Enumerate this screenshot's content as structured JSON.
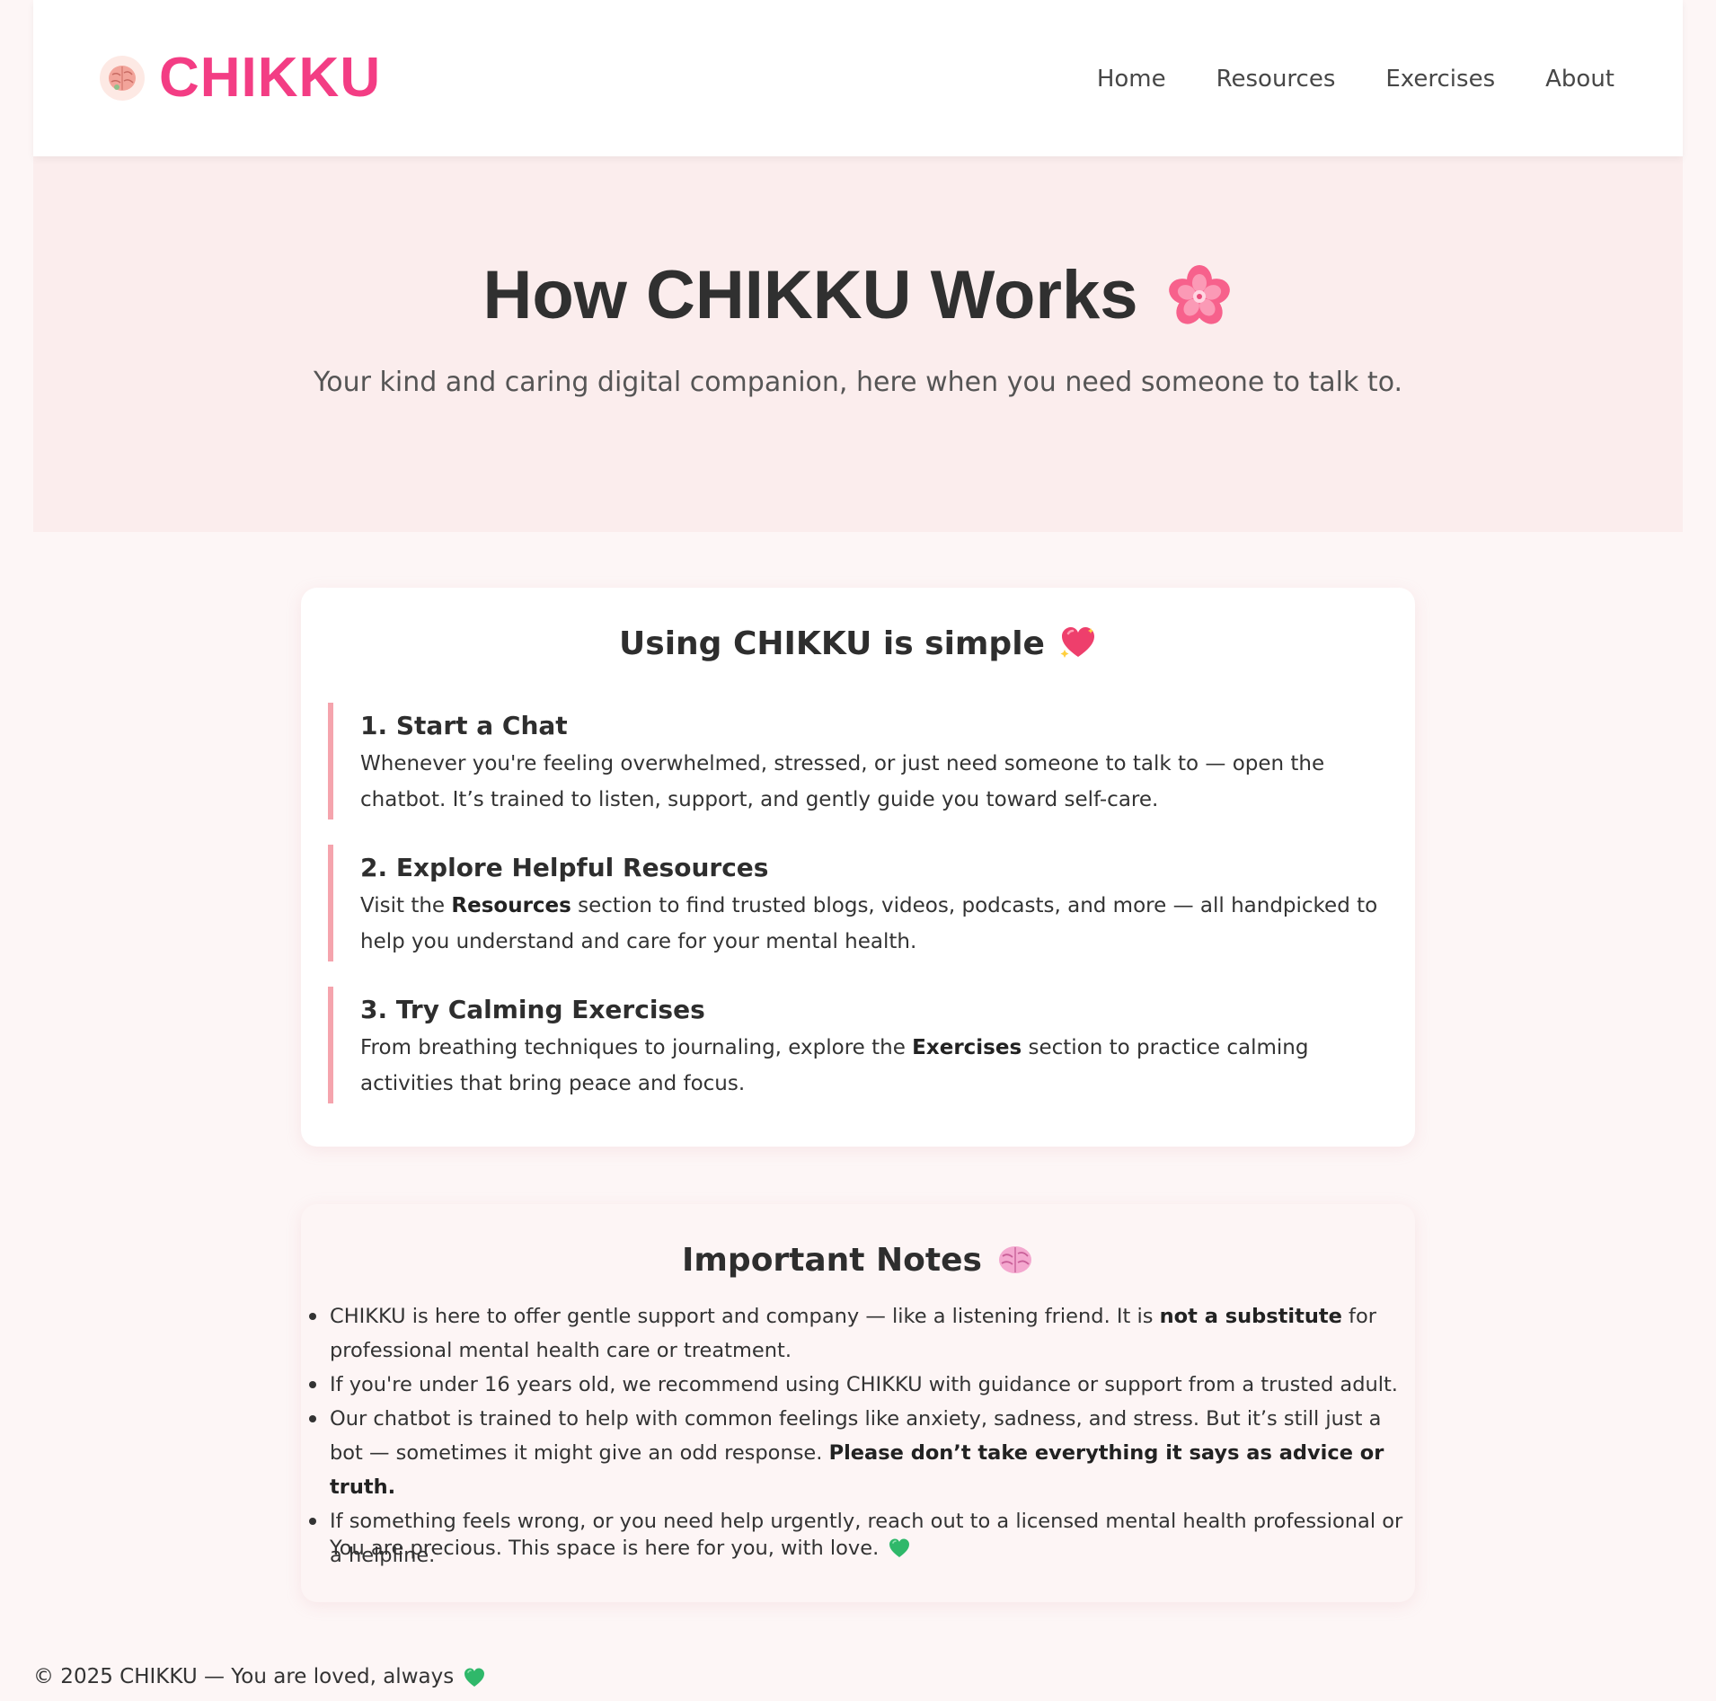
{
  "header": {
    "logo_text": "CHIKKU",
    "logo_icon": "brain-icon",
    "nav": [
      {
        "label": "Home"
      },
      {
        "label": "Resources"
      },
      {
        "label": "Exercises"
      },
      {
        "label": "About"
      }
    ]
  },
  "hero": {
    "title": "How CHIKKU Works",
    "title_icon": "cherry-blossom-icon",
    "subtitle": "Your kind and caring digital companion, here when you need someone to talk to."
  },
  "steps_card": {
    "title": "Using CHIKKU is simple",
    "title_icon": "sparkling-heart-icon",
    "steps": [
      {
        "heading": "1. Start a Chat",
        "text": "Whenever you're feeling overwhelmed, stressed, or just need someone to talk to — open the chatbot. It’s trained to listen, support, and gently guide you toward self-care."
      },
      {
        "heading": "2. Explore Helpful Resources",
        "text_before": "Visit the ",
        "text_bold": "Resources",
        "text_after": " section to find trusted blogs, videos, podcasts, and more — all handpicked to help you understand and care for your mental health."
      },
      {
        "heading": "3. Try Calming Exercises",
        "text_before": "From breathing techniques to journaling, explore the ",
        "text_bold": "Exercises",
        "text_after": " section to practice calming activities that bring peace and focus."
      }
    ]
  },
  "notes_card": {
    "title": "Important Notes",
    "title_icon": "brain-icon",
    "items": [
      {
        "before": "CHIKKU is here to offer gentle support and company — like a listening friend. It is ",
        "bold": "not a substitute",
        "after": " for professional mental health care or treatment."
      },
      {
        "before": "If you're under 16 years old, we recommend using CHIKKU with guidance or support from a trusted adult.",
        "bold": "",
        "after": ""
      },
      {
        "before": "Our chatbot is trained to help with common feelings like anxiety, sadness, and stress. But it’s still just a bot — sometimes it might give an odd response. ",
        "bold": "Please don’t take everything it says as advice or truth.",
        "after": ""
      },
      {
        "before": "If something feels wrong, or you need help urgently, reach out to a licensed mental health professional or a helpline.",
        "bold": "",
        "after": ""
      }
    ],
    "closing": "You are precious. This space is here for you, with love.",
    "closing_icon": "green-heart-icon"
  },
  "footer": {
    "text": "© 2025 CHIKKU — You are loved, always",
    "icon": "green-heart-icon"
  },
  "colors": {
    "brand_pink": "#f33d84",
    "hero_bg": "#fbeded",
    "accent_border": "#f5a4ad",
    "page_bg": "#fdf6f6"
  }
}
